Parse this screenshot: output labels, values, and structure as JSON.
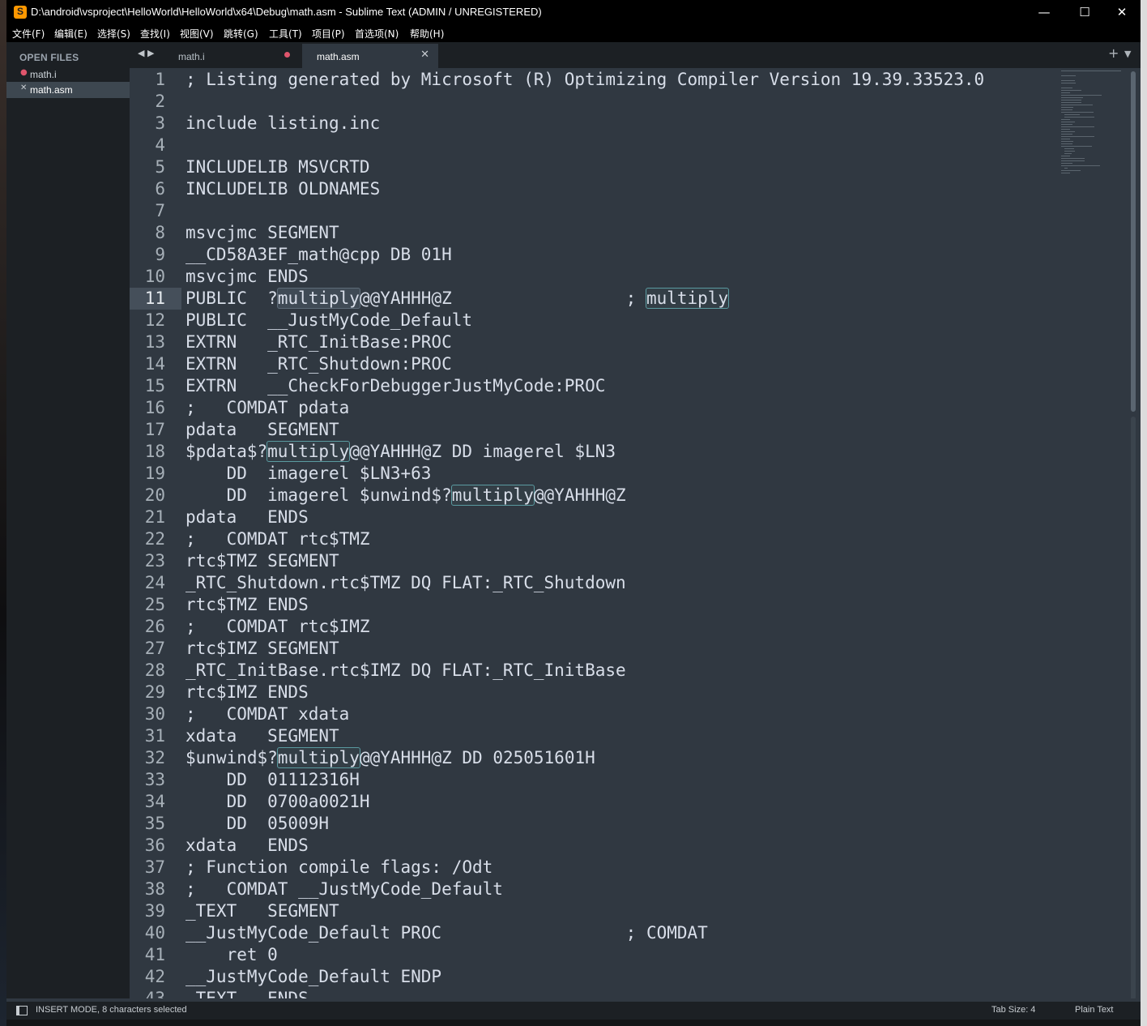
{
  "window": {
    "title": "D:\\android\\vsproject\\HelloWorld\\HelloWorld\\x64\\Debug\\math.asm - Sublime Text (ADMIN / UNREGISTERED)",
    "minimize": "—",
    "maximize": "☐",
    "close": "✕"
  },
  "menu": [
    "文件(F)",
    "编辑(E)",
    "选择(S)",
    "查找(I)",
    "视图(V)",
    "跳转(G)",
    "工具(T)",
    "项目(P)",
    "首选项(N)",
    "帮助(H)"
  ],
  "sidebar": {
    "header": "OPEN FILES",
    "files": [
      {
        "name": "math.i",
        "mark": "●",
        "mark_color": "#e0556c"
      },
      {
        "name": "math.asm",
        "mark": "✕",
        "mark_color": "#c7ccd1"
      }
    ]
  },
  "tabs": {
    "nav_left": "◀",
    "nav_right": "▶",
    "items": [
      {
        "label": "math.i",
        "state": "modified"
      },
      {
        "label": "math.asm",
        "state": "active",
        "close": "✕"
      }
    ],
    "plus": "+",
    "down": "▼"
  },
  "editor": {
    "current_line": 11,
    "selection_word": "multiply",
    "lines": [
      "; Listing generated by Microsoft (R) Optimizing Compiler Version 19.39.33523.0",
      "",
      "include listing.inc",
      "",
      "INCLUDELIB MSVCRTD",
      "INCLUDELIB OLDNAMES",
      "",
      "msvcjmc SEGMENT",
      "__CD58A3EF_math@cpp DB 01H",
      "msvcjmc ENDS",
      "PUBLIC  ?multiply@@YAHHH@Z                 ; multiply",
      "PUBLIC  __JustMyCode_Default",
      "EXTRN   _RTC_InitBase:PROC",
      "EXTRN   _RTC_Shutdown:PROC",
      "EXTRN   __CheckForDebuggerJustMyCode:PROC",
      ";   COMDAT pdata",
      "pdata   SEGMENT",
      "$pdata$?multiply@@YAHHH@Z DD imagerel $LN3",
      "    DD  imagerel $LN3+63",
      "    DD  imagerel $unwind$?multiply@@YAHHH@Z",
      "pdata   ENDS",
      ";   COMDAT rtc$TMZ",
      "rtc$TMZ SEGMENT",
      "_RTC_Shutdown.rtc$TMZ DQ FLAT:_RTC_Shutdown",
      "rtc$TMZ ENDS",
      ";   COMDAT rtc$IMZ",
      "rtc$IMZ SEGMENT",
      "_RTC_InitBase.rtc$IMZ DQ FLAT:_RTC_InitBase",
      "rtc$IMZ ENDS",
      ";   COMDAT xdata",
      "xdata   SEGMENT",
      "$unwind$?multiply@@YAHHH@Z DD 025051601H",
      "    DD  01112316H",
      "    DD  0700a0021H",
      "    DD  05009H",
      "xdata   ENDS",
      "; Function compile flags: /Odt",
      ";   COMDAT __JustMyCode_Default",
      "_TEXT   SEGMENT",
      "__JustMyCode_Default PROC                  ; COMDAT",
      "    ret 0",
      "__JustMyCode_Default ENDP",
      "_TEXT   ENDS"
    ]
  },
  "status": {
    "mode": "INSERT MODE, 8 characters selected",
    "tab_size": "Tab Size: 4",
    "syntax": "Plain Text"
  },
  "colors": {
    "editor_bg": "#303841",
    "sidebar_bg": "#1c2024",
    "text": "#d8dee9",
    "modified_dot": "#e0556c",
    "app_icon": "#ff9800"
  }
}
